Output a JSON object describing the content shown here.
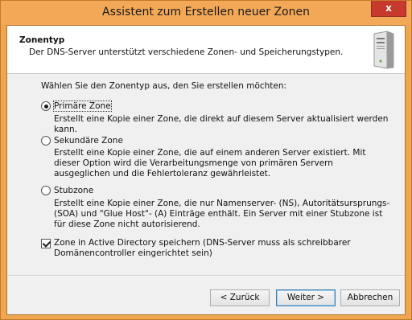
{
  "window": {
    "title": "Assistent zum Erstellen neuer Zonen",
    "close_label": "x"
  },
  "header": {
    "title": "Zonentyp",
    "subtitle": "Der DNS-Server unterstützt verschiedene Zonen- und Speicherungstypen.",
    "icon": "server-icon"
  },
  "main": {
    "intro": "Wählen Sie den Zonentyp aus, den Sie erstellen möchten:",
    "options": [
      {
        "label": "Primäre Zone",
        "checked": true,
        "description": "Erstellt eine Kopie einer Zone, die direkt auf diesem Server aktualisiert werden kann."
      },
      {
        "label": "Sekundäre Zone",
        "checked": false,
        "description": "Erstellt eine Kopie einer Zone, die auf einem anderen Server existiert. Mit dieser Option wird die Verarbeitungsmenge von primären Servern ausgeglichen und die Fehlertoleranz gewährleistet."
      },
      {
        "label": "Stubzone",
        "checked": false,
        "description": "Erstellt eine Kopie einer Zone, die nur Namenserver- (NS), Autoritätsursprungs- (SOA) und \"Glue Host\"- (A) Einträge enthält. Ein Server mit einer Stubzone ist für diese Zone nicht autorisierend."
      }
    ],
    "ad_checkbox": {
      "label": "Zone in Active Directory speichern (DNS-Server muss als schreibbarer Domänencontroller eingerichtet sein)",
      "checked": true
    }
  },
  "footer": {
    "back_label": "< Zurück",
    "next_label": "Weiter >",
    "cancel_label": "Abbrechen"
  }
}
